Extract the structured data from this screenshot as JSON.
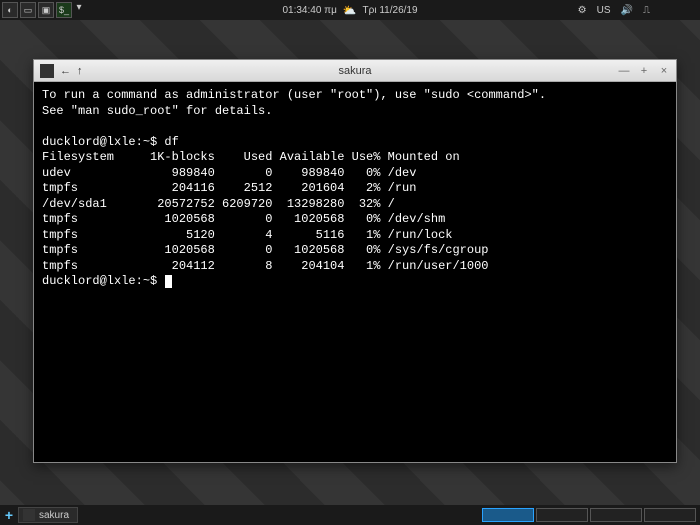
{
  "top_panel": {
    "time": "01:34:40 πμ",
    "date": "Τρι 11/26/19",
    "kbd": "US"
  },
  "window": {
    "title": "sakura"
  },
  "terminal": {
    "motd1": "To run a command as administrator (user \"root\"), use \"sudo <command>\".",
    "motd2": "See \"man sudo_root\" for details.",
    "prompt": "ducklord@lxle:~$",
    "cmd": "df",
    "header": "Filesystem     1K-blocks    Used Available Use% Mounted on",
    "rows": [
      "udev              989840       0    989840   0% /dev",
      "tmpfs             204116    2512    201604   2% /run",
      "/dev/sda1       20572752 6209720  13298280  32% /",
      "tmpfs            1020568       0   1020568   0% /dev/shm",
      "tmpfs               5120       4      5116   1% /run/lock",
      "tmpfs            1020568       0   1020568   0% /sys/fs/cgroup",
      "tmpfs             204112       8    204104   1% /run/user/1000"
    ]
  },
  "taskbar": {
    "item": "sakura"
  }
}
